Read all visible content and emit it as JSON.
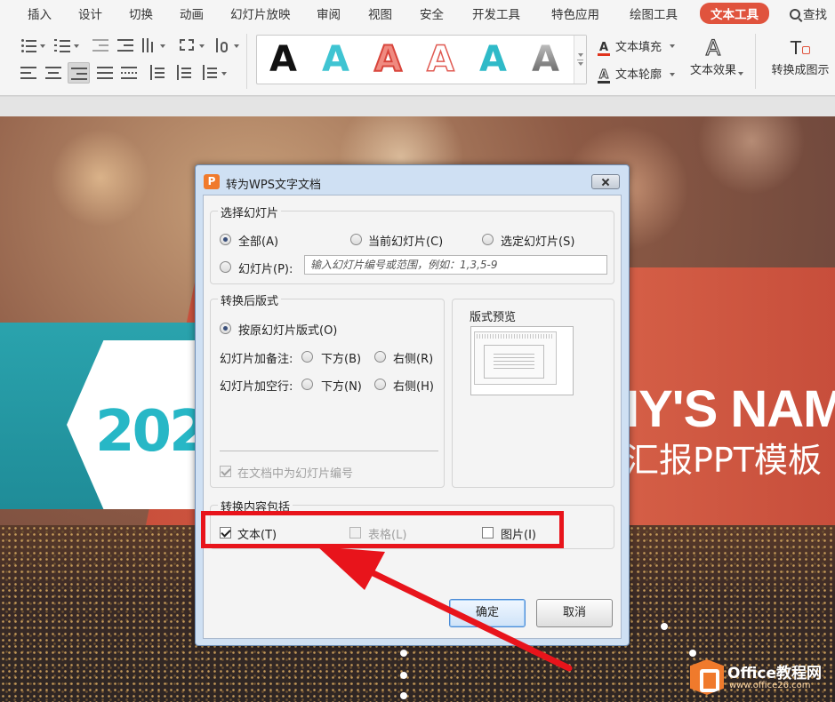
{
  "menubar": {
    "items": [
      "插入",
      "设计",
      "切换",
      "动画",
      "幻灯片放映",
      "审阅",
      "视图",
      "安全",
      "开发工具",
      "特色应用",
      "绘图工具",
      "文本工具"
    ],
    "active_item": "文本工具",
    "search_label": "查找"
  },
  "toolbar": {
    "text_fill": "文本填充",
    "text_outline": "文本轮廓",
    "text_effect": "文本效果",
    "convert_to_image": "转换成图示",
    "gallery_letters": [
      "A",
      "A",
      "A",
      "A",
      "A",
      "A"
    ]
  },
  "slide": {
    "year_text": "202",
    "name_text": "IY'S NAME",
    "subtitle_text": "汇报PPT模板"
  },
  "dialog": {
    "title": "转为WPS文字文档",
    "select_slides": {
      "legend": "选择幻灯片",
      "all": "全部(A)",
      "current": "当前幻灯片(C)",
      "selected": "选定幻灯片(S)",
      "slides": "幻灯片(P):",
      "slides_placeholder": "输入幻灯片编号或范围，例如：1,3,5-9"
    },
    "layout": {
      "legend": "转换后版式",
      "original": "按原幻灯片版式(O)",
      "notes_label": "幻灯片加备注:",
      "notes_below": "下方(B)",
      "notes_right": "右侧(R)",
      "blank_label": "幻灯片加空行:",
      "blank_below": "下方(N)",
      "blank_right": "右侧(H)",
      "number_slides": "在文档中为幻灯片编号"
    },
    "preview": {
      "legend": "版式预览"
    },
    "content": {
      "legend": "转换内容包括",
      "text": "文本(T)",
      "table": "表格(L)",
      "image": "图片(I)"
    },
    "ok": "确定",
    "cancel": "取消"
  },
  "watermark": {
    "brand": "Office教程网",
    "url": "www.office26.com"
  },
  "colors": {
    "accent_tab": "#e0533d",
    "highlight": "#e8141b",
    "teal": "#27b7c6"
  }
}
